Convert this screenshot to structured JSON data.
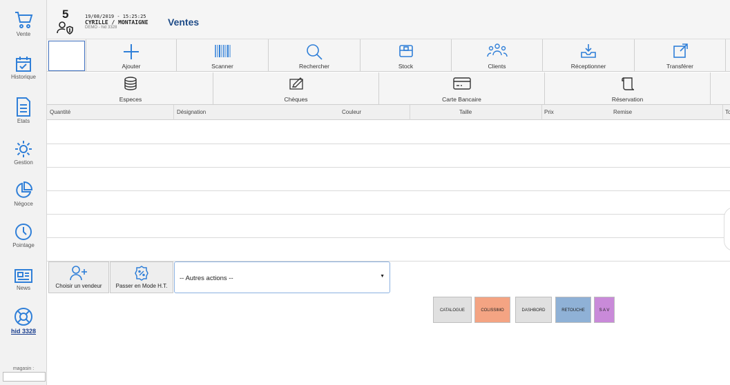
{
  "sidebar": {
    "items": [
      {
        "label": "Vente",
        "icon": "cart-icon"
      },
      {
        "label": "Historique",
        "icon": "calendar-check-icon"
      },
      {
        "label": "Etats",
        "icon": "document-icon"
      },
      {
        "label": "Gestion",
        "icon": "gear-icon"
      },
      {
        "label": "Négoce",
        "icon": "pie-chart-icon"
      },
      {
        "label": "Pointage",
        "icon": "clock-icon"
      },
      {
        "label": "News",
        "icon": "newspaper-icon"
      },
      {
        "label": "hid 3328",
        "icon": "lifebuoy-icon"
      }
    ],
    "magasin_label": "magasin :"
  },
  "header": {
    "number": "5",
    "datetime": "19/08/2019 - 15:25:25",
    "store": "CYRILLE / MONTAIGNE",
    "demo": "DEMO - hid 3328",
    "title": "Ventes"
  },
  "toolbar": {
    "row1": [
      {
        "label": "Ajouter",
        "icon": "plus-icon"
      },
      {
        "label": "Scanner",
        "icon": "barcode-icon"
      },
      {
        "label": "Rechercher",
        "icon": "search-icon"
      },
      {
        "label": "Stock",
        "icon": "box-icon"
      },
      {
        "label": "Clients",
        "icon": "users-icon"
      },
      {
        "label": "Réceptionner",
        "icon": "inbox-download-icon"
      },
      {
        "label": "Transférer",
        "icon": "external-link-icon"
      }
    ],
    "row2": [
      {
        "label": "Especes",
        "icon": "coins-icon"
      },
      {
        "label": "Chèques",
        "icon": "cheque-icon"
      },
      {
        "label": "Carte Bancaire",
        "icon": "credit-card-icon"
      },
      {
        "label": "Réservation",
        "icon": "scroll-icon"
      }
    ]
  },
  "table": {
    "columns": [
      "Quantité",
      "Désignation",
      "Couleur",
      "Taille",
      "Prix",
      "Remise",
      "To"
    ],
    "rows": [
      [],
      [],
      [],
      [],
      [],
      []
    ]
  },
  "actions": {
    "choose_seller": "Choisir un vendeur",
    "ht_mode": "Passer en Mode H.T.",
    "other_actions": "-- Autres actions --"
  },
  "chips": [
    {
      "label": "CATALOGUE",
      "color": "#e0e0e0"
    },
    {
      "label": "COLISSIMO",
      "color": "#f4a483"
    },
    {
      "label": "DASHBORD",
      "color": "#e0e0e0"
    },
    {
      "label": "RETOUCHE",
      "color": "#8fb1d6"
    },
    {
      "label": "S A V",
      "color": "#c98ad9"
    }
  ],
  "colors": {
    "accent": "#2f7fd8",
    "title": "#1e4b87"
  }
}
